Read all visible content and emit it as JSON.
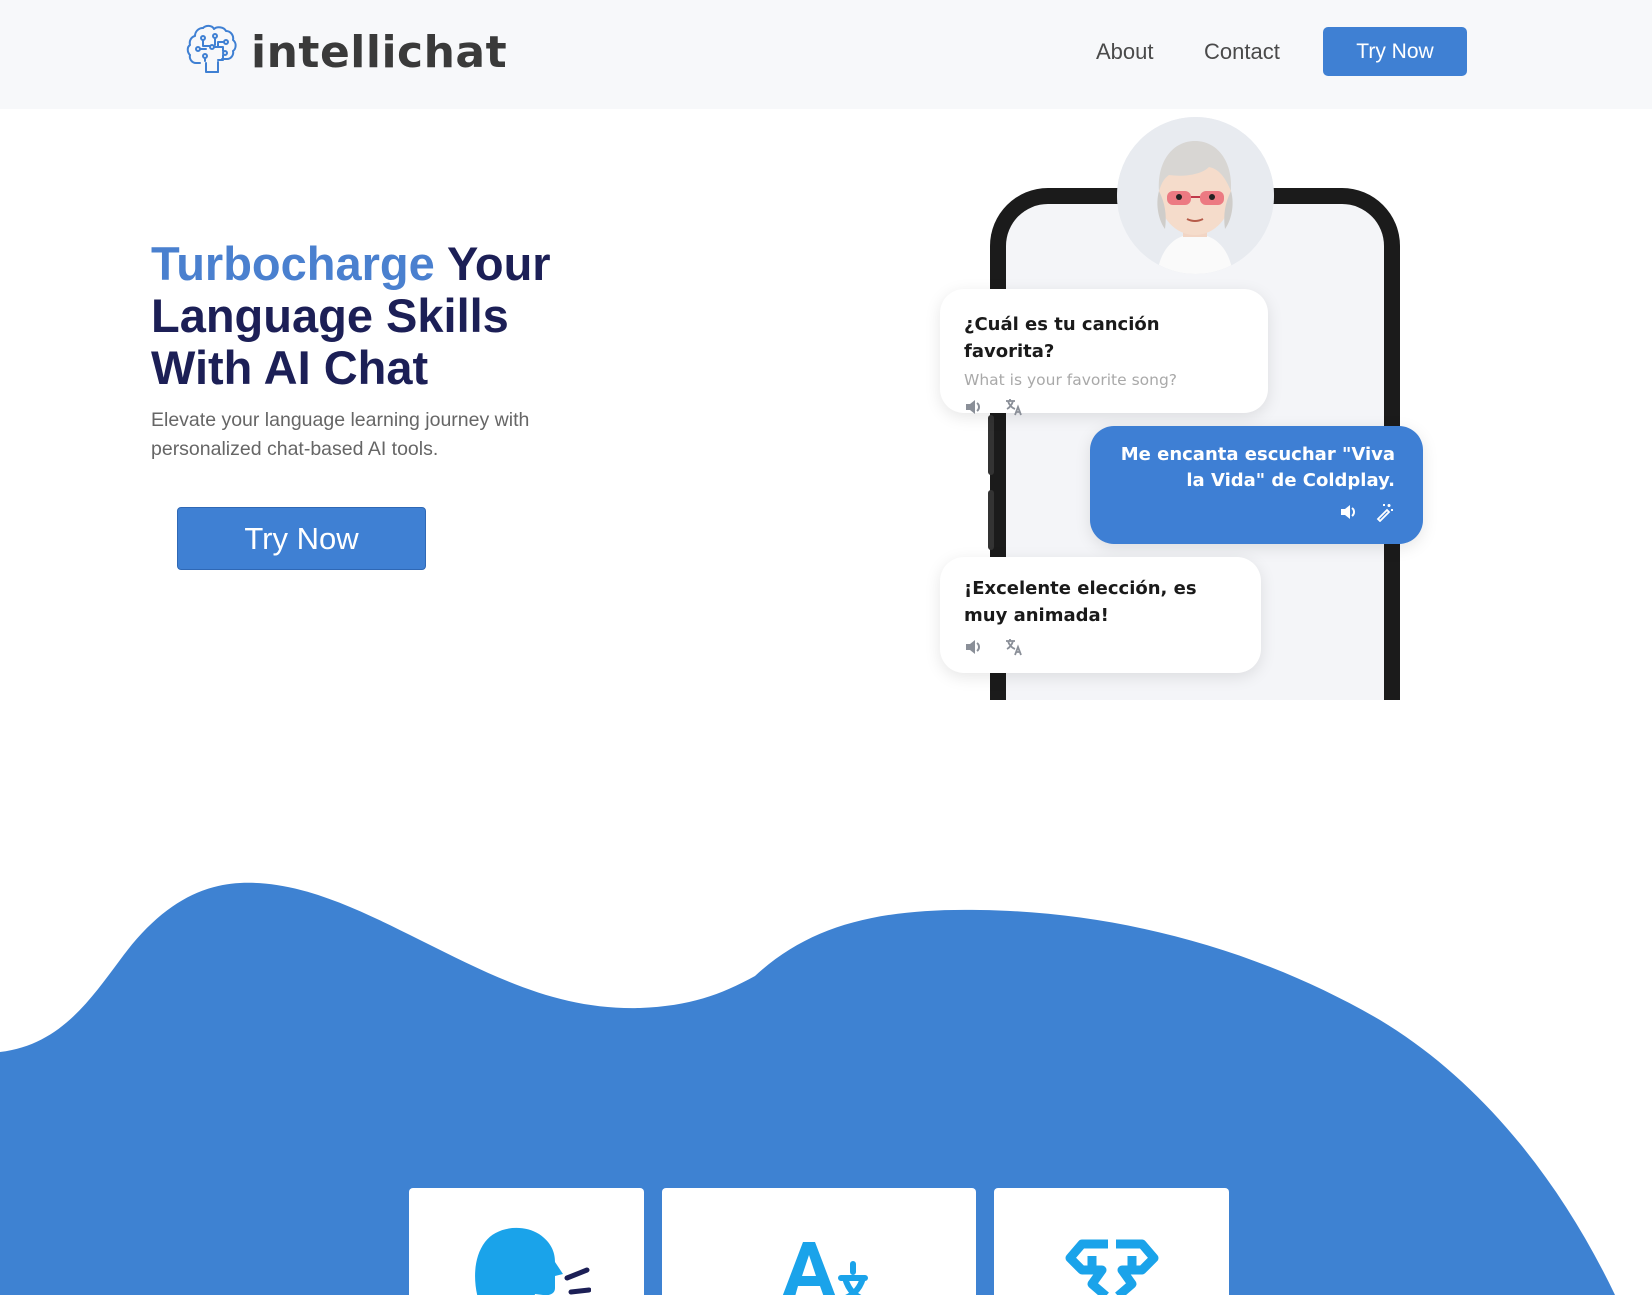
{
  "header": {
    "logo_text": "intellichat",
    "nav": {
      "about": "About",
      "contact": "Contact"
    },
    "cta": "Try Now"
  },
  "hero": {
    "title_accent": "Turbocharge",
    "title_rest": "Your Language Skills With AI Chat",
    "subtitle": "Elevate your language learning journey with personalized chat-based AI tools.",
    "cta": "Try Now"
  },
  "chat": {
    "message_1": {
      "text": "¿Cuál es tu canción favorita?",
      "translation": "What is your favorite song?"
    },
    "message_2": {
      "text": "Me encanta escuchar \"Viva la Vida\" de Coldplay."
    },
    "message_3": {
      "text": "¡Excelente elección, es muy animada!"
    }
  },
  "icons": {
    "logo": "brain-circuit-icon",
    "speaker": "speaker-icon",
    "translate": "translate-icon",
    "magic": "magic-wand-icon",
    "feature_1": "speaking-head-icon",
    "feature_2": "letters-icon",
    "feature_3": "brain-icon"
  },
  "colors": {
    "accent": "#3f80d3",
    "heading": "#1c1f56",
    "wave": "#3e82d2",
    "feature_icon": "#1aa3ea"
  }
}
